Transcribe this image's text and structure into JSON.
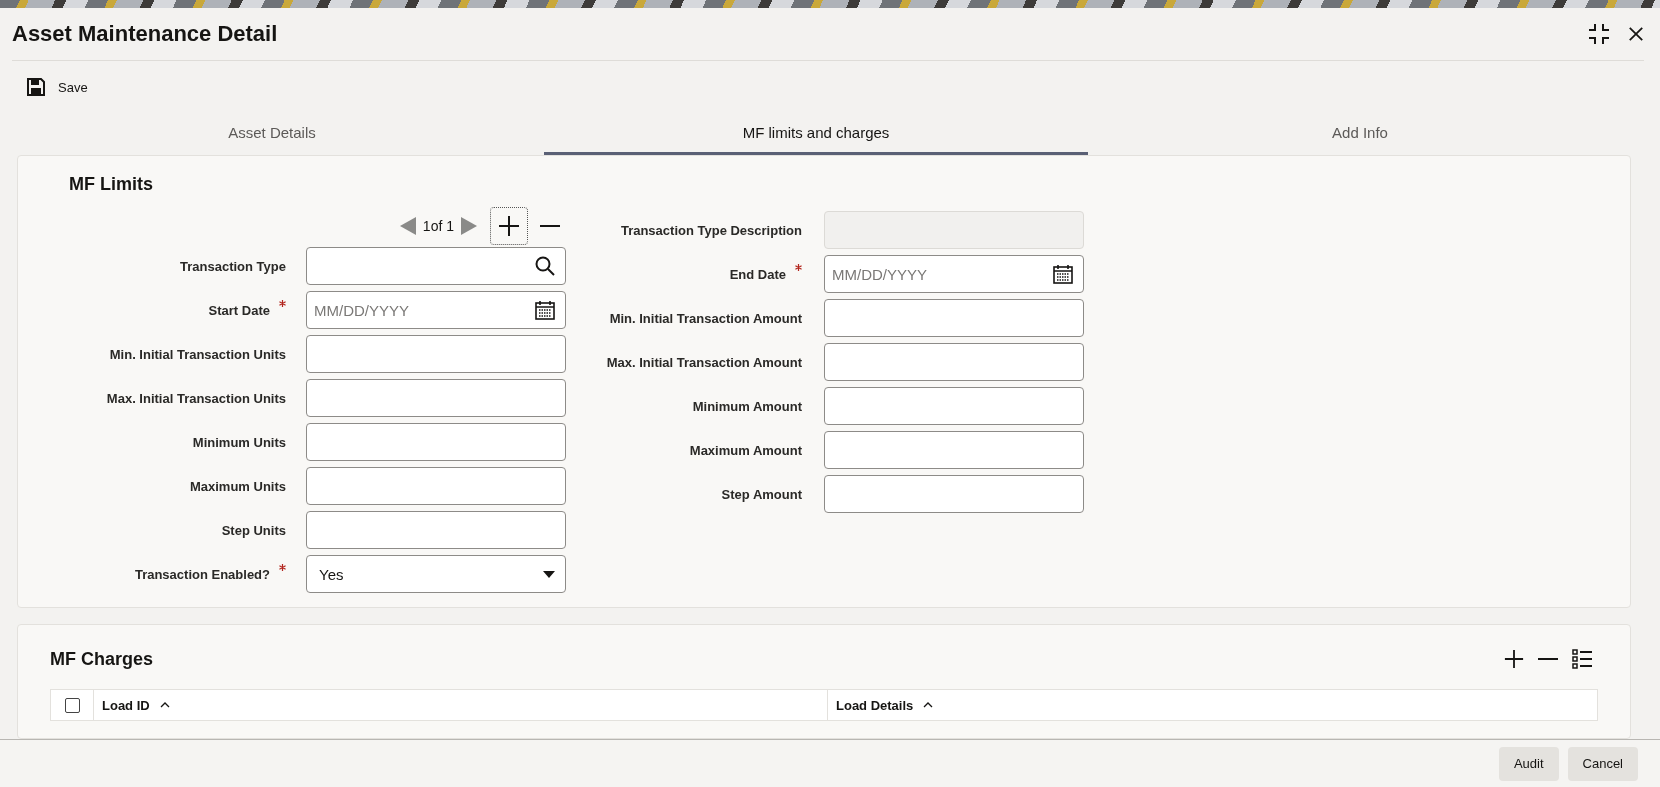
{
  "window": {
    "title": "Asset Maintenance Detail"
  },
  "toolbar": {
    "save": "Save"
  },
  "tabs": [
    {
      "label": "Asset Details",
      "selected": false
    },
    {
      "label": "MF limits and charges",
      "selected": true
    },
    {
      "label": "Add Info",
      "selected": false
    }
  ],
  "mf_limits": {
    "title": "MF Limits",
    "pager": {
      "text": "1of 1"
    },
    "left_fields": [
      {
        "label": "Transaction Type",
        "kind": "lookup",
        "required": false
      },
      {
        "label": "Start Date",
        "kind": "date",
        "required": true,
        "placeholder": "MM/DD/YYYY"
      },
      {
        "label": "Min. Initial Transaction Units",
        "kind": "text",
        "required": false
      },
      {
        "label": "Max. Initial Transaction Units",
        "kind": "text",
        "required": false
      },
      {
        "label": "Minimum Units",
        "kind": "text",
        "required": false
      },
      {
        "label": "Maximum Units",
        "kind": "text",
        "required": false
      },
      {
        "label": "Step Units",
        "kind": "text",
        "required": false
      },
      {
        "label": "Transaction Enabled?",
        "kind": "select",
        "required": true,
        "value": "Yes"
      }
    ],
    "right_fields": [
      {
        "label": "Transaction Type Description",
        "kind": "text",
        "required": false,
        "disabled": true
      },
      {
        "label": "End Date",
        "kind": "date",
        "required": true,
        "placeholder": "MM/DD/YYYY"
      },
      {
        "label": "Min. Initial Transaction Amount",
        "kind": "text",
        "required": false
      },
      {
        "label": "Max. Initial Transaction Amount",
        "kind": "text",
        "required": false
      },
      {
        "label": "Minimum Amount",
        "kind": "text",
        "required": false
      },
      {
        "label": "Maximum Amount",
        "kind": "text",
        "required": false
      },
      {
        "label": "Step Amount",
        "kind": "text",
        "required": false
      }
    ]
  },
  "mf_charges": {
    "title": "MF Charges",
    "table": {
      "columns": [
        "Load ID",
        "Load Details"
      ],
      "all_checked": false
    }
  },
  "footer": {
    "buttons": [
      "Audit",
      "Cancel"
    ]
  }
}
